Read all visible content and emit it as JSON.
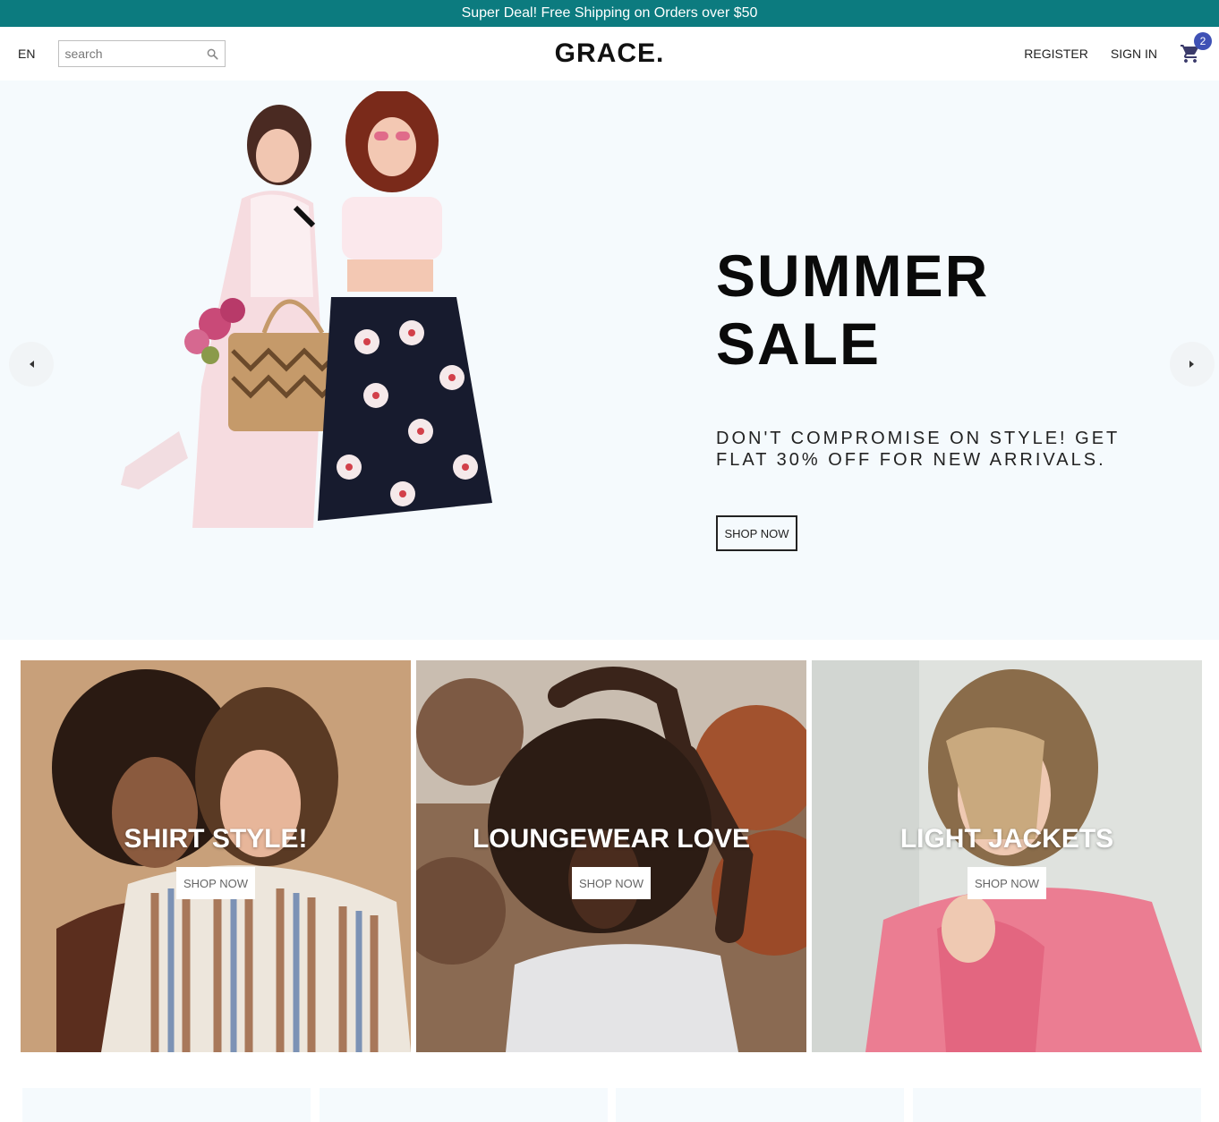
{
  "announcement": {
    "text": "Super Deal! Free Shipping on Orders over $50"
  },
  "navbar": {
    "language": "EN",
    "search": {
      "placeholder": "search",
      "value": ""
    },
    "logo": "GRACE.",
    "links": {
      "register": "REGISTER",
      "sign_in": "SIGN IN"
    },
    "cart_count": "2",
    "badge_color": "#3f51b5"
  },
  "hero": {
    "title": "SUMMER SALE",
    "description": "DON'T COMPROMISE ON STYLE! GET FLAT 30% OFF FOR NEW ARRIVALS.",
    "button": "SHOP NOW",
    "background": "#f5fafd"
  },
  "categories": [
    {
      "title": "SHIRT STYLE!",
      "button": "SHOP NOW"
    },
    {
      "title": "LOUNGEWEAR LOVE",
      "button": "SHOP NOW"
    },
    {
      "title": "LIGHT JACKETS",
      "button": "SHOP NOW"
    }
  ],
  "colors": {
    "accent_teal": "#0c7b7f",
    "text_dark": "#111111"
  }
}
